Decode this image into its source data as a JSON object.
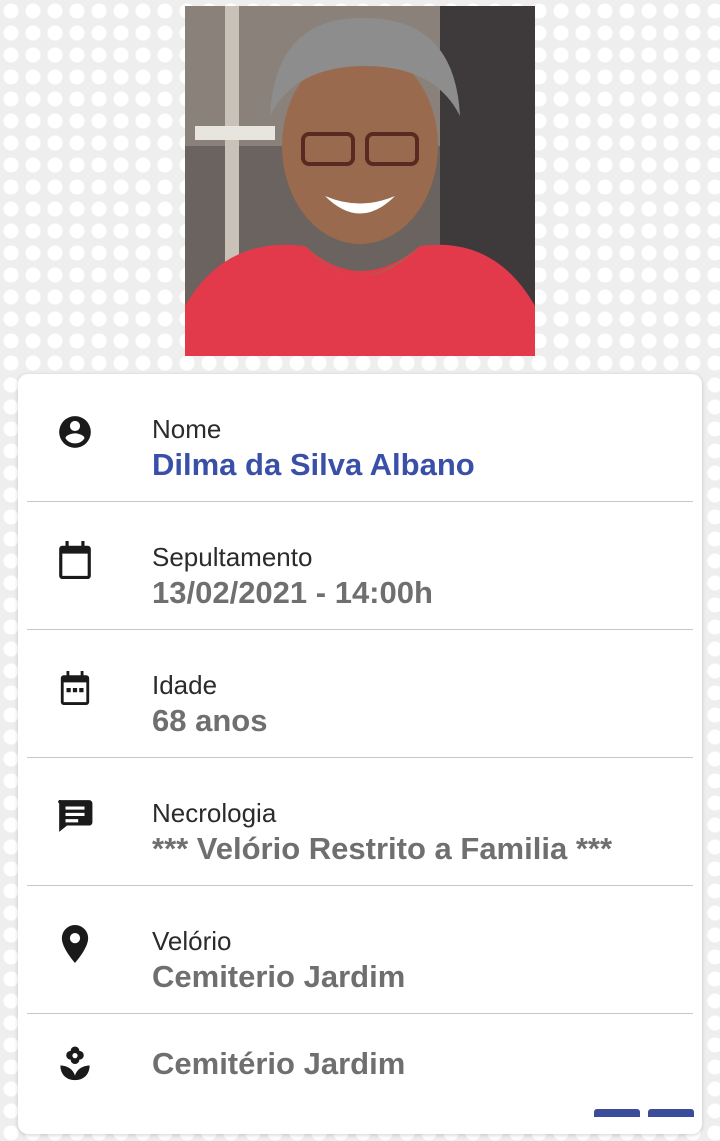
{
  "colors": {
    "accent": "#3a4fa8",
    "value_gray": "#6f6f6f",
    "label_dark": "#2b2b2b"
  },
  "photo": {
    "alt": "Foto do falecido"
  },
  "fields": {
    "nome": {
      "icon": "account-circle-icon",
      "label": "Nome",
      "value": "Dilma da Silva Albano"
    },
    "sepultamento": {
      "icon": "calendar-icon",
      "label": "Sepultamento",
      "value": "13/02/2021 - 14:00h"
    },
    "idade": {
      "icon": "calendar-dots-icon",
      "label": "Idade",
      "value": "68 anos"
    },
    "necrologia": {
      "icon": "comment-icon",
      "label": "Necrologia",
      "value": "*** Velório Restrito a Familia ***"
    },
    "velorio": {
      "icon": "map-marker-icon",
      "label": "Velório",
      "value": "Cemiterio Jardim"
    },
    "cemiterio": {
      "icon": "flower-icon",
      "value": "Cemitério Jardim"
    }
  }
}
